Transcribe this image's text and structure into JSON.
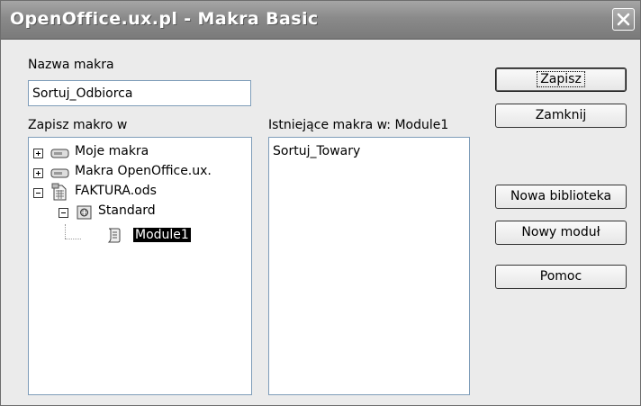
{
  "window": {
    "title": "OpenOffice.ux.pl - Makra Basic",
    "close_icon": "close-icon"
  },
  "macro_name": {
    "label": "Nazwa makra",
    "value": "Sortuj_Odbiorca"
  },
  "save_in": {
    "label": "Zapisz makro w",
    "tree": [
      {
        "label": "Moje makra",
        "icon": "drawer-icon",
        "expander": "plus"
      },
      {
        "label": "Makra OpenOffice.ux.",
        "icon": "drawer-icon",
        "expander": "plus"
      },
      {
        "label": "FAKTURA.ods",
        "icon": "spreadsheet-document-icon",
        "expander": "minus"
      },
      {
        "label": "Standard",
        "icon": "library-icon",
        "expander": "minus"
      },
      {
        "label": "Module1",
        "icon": "module-icon",
        "selected": true
      }
    ]
  },
  "existing": {
    "label": "Istniejące makra w: Module1",
    "items": [
      "Sortuj_Towary"
    ]
  },
  "buttons": {
    "save": "Zapisz",
    "close": "Zamknij",
    "new_library": "Nowa biblioteka",
    "new_module": "Nowy moduł",
    "help": "Pomoc"
  },
  "colors": {
    "titlebar": "#8a8a8a",
    "selection": "#000000",
    "dialog_bg": "#ebebeb"
  }
}
